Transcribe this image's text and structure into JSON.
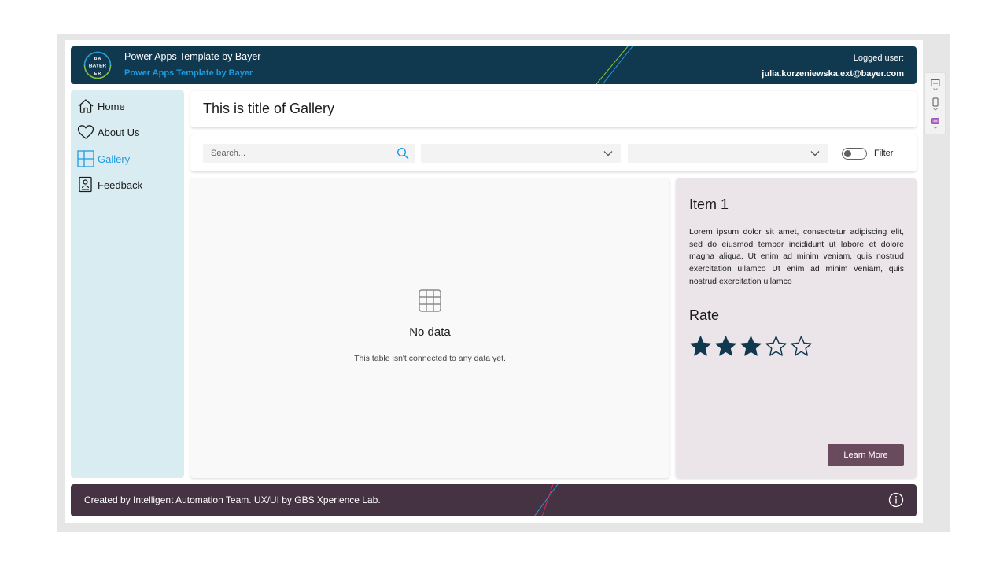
{
  "header": {
    "title": "Power Apps Template by Bayer",
    "subtitle": "Power Apps Template by Bayer",
    "user_label": "Logged user:",
    "user_email": "julia.korzeniewska.ext@bayer.com",
    "logo_text": "BAYER"
  },
  "sidebar": {
    "items": [
      {
        "label": "Home",
        "icon": "home-icon",
        "active": false
      },
      {
        "label": "About Us",
        "icon": "heart-icon",
        "active": false
      },
      {
        "label": "Gallery",
        "icon": "gallery-icon",
        "active": true
      },
      {
        "label": "Feedback",
        "icon": "feedback-icon",
        "active": false
      }
    ]
  },
  "page": {
    "title": "This is title of Gallery"
  },
  "filters": {
    "search_placeholder": "Search...",
    "dropdown1_value": "",
    "dropdown2_value": "",
    "toggle_on": false,
    "toggle_label": "Filter"
  },
  "gallery": {
    "empty_title": "No data",
    "empty_message": "This table isn't connected to any data yet."
  },
  "detail": {
    "item_title": "Item 1",
    "description": "Lorem ipsum dolor sit amet, consectetur adipiscing elit, sed do eiusmod tempor incididunt ut labore et dolore magna aliqua. Ut enim ad minim veniam, quis nostrud exercitation ullamco Ut enim ad minim veniam, quis nostrud exercitation ullamco",
    "rate_label": "Rate",
    "rating": 3,
    "rating_max": 5,
    "button_label": "Learn More"
  },
  "footer": {
    "text": "Created by Intelligent Automation Team. UX/UI by GBS Xperience Lab."
  },
  "colors": {
    "header_bg": "#10384f",
    "accent": "#1e9be0",
    "sidebar_bg": "#d9ecf2",
    "detail_bg": "#ebe5ea",
    "button_bg": "#6a4a5d",
    "footer_bg": "#453242"
  }
}
